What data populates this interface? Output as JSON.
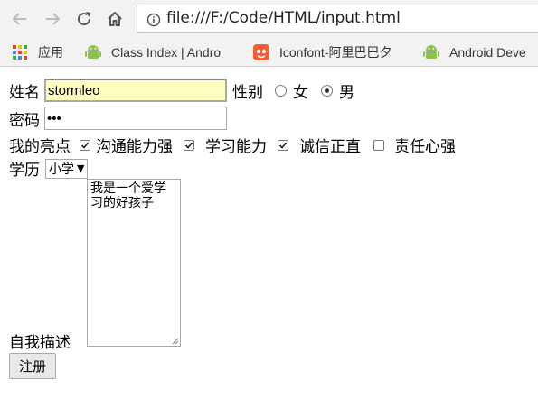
{
  "browser": {
    "url": "file:///F:/Code/HTML/input.html",
    "bookmarks": [
      {
        "label": "应用",
        "icon": "apps-grid-icon"
      },
      {
        "label": "Class Index | Andro",
        "icon": "android-icon"
      },
      {
        "label": "Iconfont-阿里巴巴夕",
        "icon": "iconfont-icon"
      },
      {
        "label": "Android Deve",
        "icon": "android-icon"
      }
    ]
  },
  "form": {
    "name_label": "姓名",
    "name_value": "stormleo",
    "gender_label": "性别",
    "gender_options": [
      {
        "label": "女",
        "checked": false
      },
      {
        "label": "男",
        "checked": true
      }
    ],
    "password_label": "密码",
    "password_value": "•••",
    "highlights_label": "我的亮点",
    "highlights": [
      {
        "label": "沟通能力强",
        "checked": true
      },
      {
        "label": "学习能力",
        "checked": true
      },
      {
        "label": "诚信正直",
        "checked": true
      },
      {
        "label": "责任心强",
        "checked": false
      }
    ],
    "education_label": "学历",
    "education_selected": "小学",
    "description_label": "自我描述",
    "description_value": "我是一个爱学习的好孩子",
    "submit_label": "注册"
  }
}
